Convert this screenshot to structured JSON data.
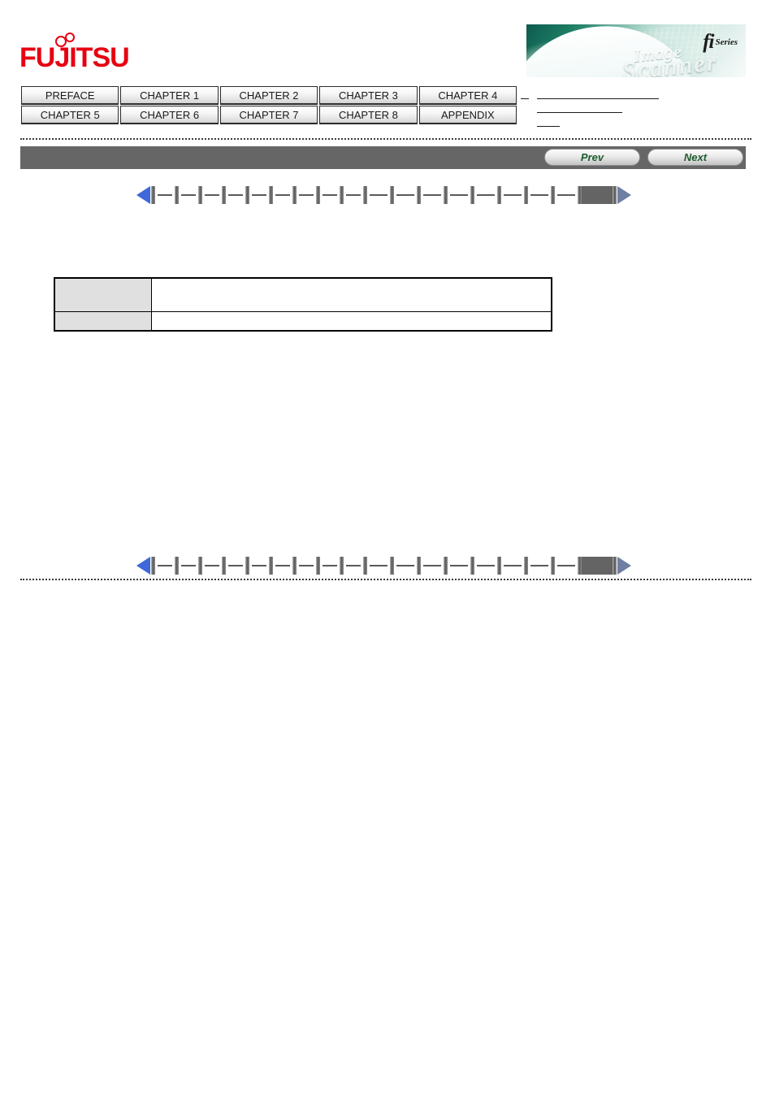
{
  "header": {
    "brand": {
      "name": "FUJITSU",
      "color": "#e60012",
      "logo_icon": "fujitsu-logo"
    },
    "banner": {
      "product_mark": "fi",
      "product_series": "Series",
      "wordmark_top": "Image",
      "wordmark_bottom": "Scanner",
      "alt": "fi Series Image Scanner"
    }
  },
  "nav_tabs": {
    "row1": [
      {
        "label": "PREFACE",
        "name": "tab-preface"
      },
      {
        "label": "CHAPTER 1",
        "name": "tab-chapter-1"
      },
      {
        "label": "CHAPTER 2",
        "name": "tab-chapter-2"
      },
      {
        "label": "CHAPTER 3",
        "name": "tab-chapter-3"
      },
      {
        "label": "CHAPTER 4",
        "name": "tab-chapter-4"
      }
    ],
    "row2": [
      {
        "label": "CHAPTER 5",
        "name": "tab-chapter-5"
      },
      {
        "label": "CHAPTER 6",
        "name": "tab-chapter-6"
      },
      {
        "label": "CHAPTER 7",
        "name": "tab-chapter-7"
      },
      {
        "label": "CHAPTER 8",
        "name": "tab-chapter-8"
      },
      {
        "label": "APPENDIX",
        "name": "tab-appendix"
      }
    ]
  },
  "toolbar": {
    "prev_label": "Prev",
    "next_label": "Next",
    "bar_color": "#666666",
    "button_text_color": "#1d5c2e"
  },
  "pager": {
    "prev_arrow_icon": "triangle-left-icon",
    "next_arrow_icon": "triangle-right-icon",
    "prev_arrow_color": "#3f68d8",
    "next_arrow_color": "#6e7fa3",
    "current_marker_color": "#646464",
    "segment_widths": [
      18,
      18,
      18,
      18,
      18,
      18,
      18,
      18,
      18,
      22,
      22,
      22,
      22,
      22,
      22,
      22,
      22
    ],
    "segment_count": 17,
    "current_segment_index": 17
  },
  "content": {
    "table": {
      "rows": [
        {
          "label": "",
          "value": ""
        },
        {
          "label": "",
          "value": ""
        }
      ]
    }
  }
}
